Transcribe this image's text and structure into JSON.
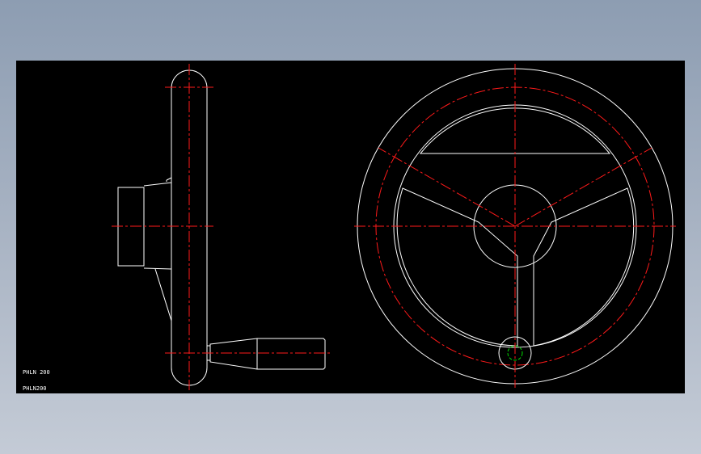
{
  "viewport": {
    "background": "#000000",
    "labels": [
      "PHLN 200",
      "PHLN200"
    ]
  },
  "colors": {
    "outline": "#ffffff",
    "centerline": "#ff1a1a",
    "hole_marker": "#00dd00"
  },
  "drawing_views": [
    "side-view",
    "front-view"
  ]
}
